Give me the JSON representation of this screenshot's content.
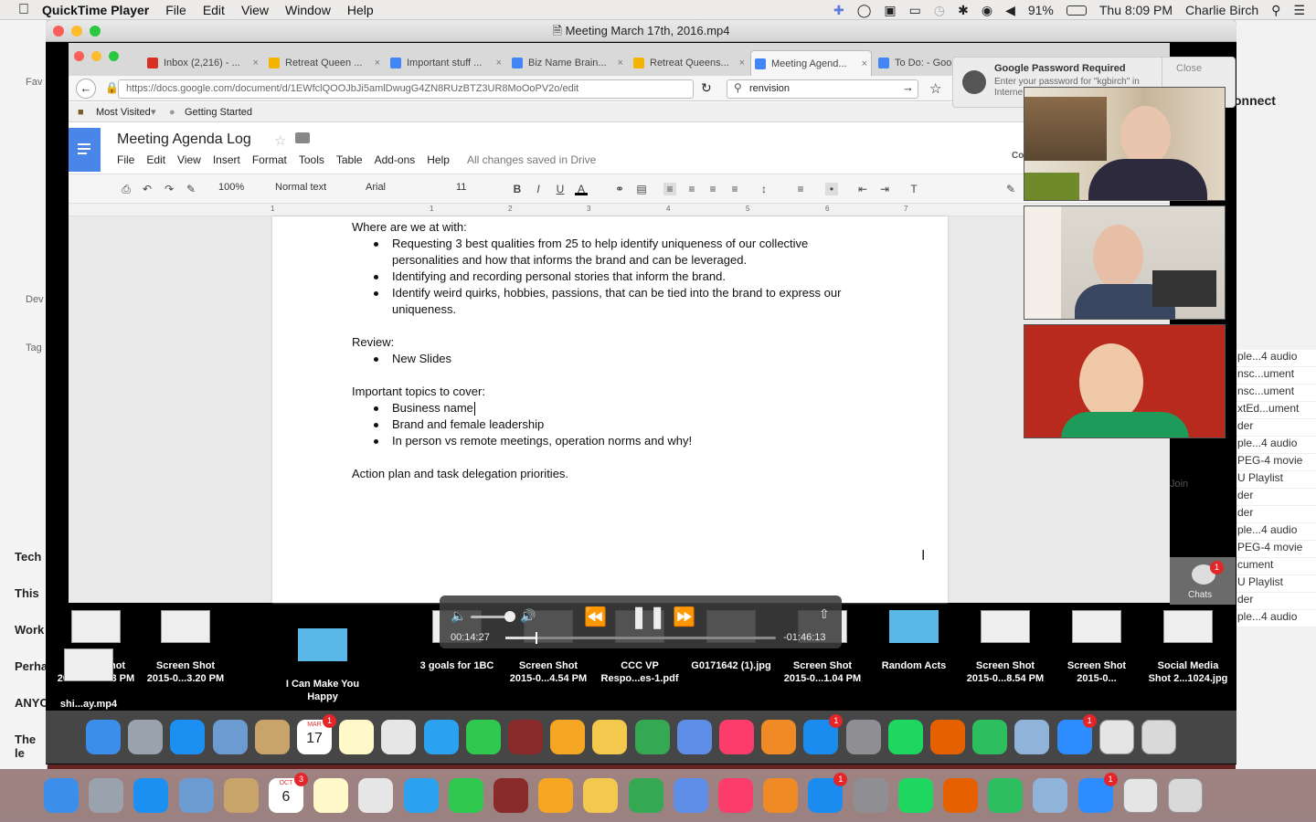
{
  "menubar": {
    "app": "QuickTime Player",
    "items": [
      "File",
      "Edit",
      "View",
      "Window",
      "Help"
    ],
    "battery": "91%",
    "clock": "Thu 8:09 PM",
    "user": "Charlie Birch"
  },
  "qt": {
    "window_title": "Meeting March 17th, 2016.mp4",
    "elapsed": "00:14:27",
    "remaining": "-01:46:13",
    "progress": 0.11
  },
  "browser": {
    "tabs": [
      {
        "label": "Inbox (2,216) - ...",
        "icon_color": "#d93025"
      },
      {
        "label": "Retreat Queen ...",
        "icon_color": "#f4b400"
      },
      {
        "label": "Important stuff ...",
        "icon_color": "#4285f4"
      },
      {
        "label": "Biz Name Brain...",
        "icon_color": "#4285f4"
      },
      {
        "label": "Retreat Queens...",
        "icon_color": "#f4b400"
      },
      {
        "label": "Meeting Agend...",
        "icon_color": "#4285f4"
      },
      {
        "label": "To Do: - Goo",
        "icon_color": "#4285f4"
      }
    ],
    "url": "https://docs.google.com/document/d/1EWfclQOOJbJi5amlDwugG4ZN8RUzBTZ3UR8MoOoPV2o/edit",
    "search": "renvision",
    "bookmarks": [
      "Most Visited",
      "Getting Started"
    ]
  },
  "notification": {
    "title": "Google Password Required",
    "body": "Enter your password for \"kgbirch\" in Interne",
    "close": "Close"
  },
  "docs": {
    "title": "Meeting Agenda Log",
    "menu": [
      "File",
      "Edit",
      "View",
      "Insert",
      "Format",
      "Tools",
      "Table",
      "Add-ons",
      "Help"
    ],
    "saved": "All changes saved in Drive",
    "zoom": "100%",
    "style": "Normal text",
    "font": "Arial",
    "size": "11",
    "ruler": [
      "1",
      "1",
      "2",
      "3",
      "4",
      "5",
      "6",
      "7"
    ],
    "lines": {
      "h1": "Where are we at with:",
      "b1a": "Requesting 3 best qualities from 25 to help identify uniqueness of our collective",
      "b1b": "personalities and how that informs the brand and can be leveraged.",
      "b2": "Identifying and recording personal stories that inform the brand.",
      "b3a": "Identify weird quirks, hobbies, passions, that can be tied into the brand to express our",
      "b3b": "uniqueness.",
      "h2": "Review:",
      "b4": "New Slides",
      "h3": "Important topics to cover:",
      "b5": "Business name",
      "b6": "Brand and female leadership",
      "b7": "In person vs remote meetings, operation norms and why!",
      "h4": "Action plan and task delegation priorities."
    }
  },
  "side_panel": {
    "connect": "onnect",
    "join": "Join",
    "chats": "Chats",
    "chats_badge": "1",
    "partial_c": "Co"
  },
  "right_list": [
    "ple...4 audio",
    "nsc...ument",
    "nsc...ument",
    "xtEd...ument",
    "der",
    "ple...4 audio",
    "PEG-4 movie",
    "U Playlist",
    "der",
    "der",
    "ple...4 audio",
    "PEG-4 movie",
    "cument",
    "U Playlist",
    "der",
    "ple...4 audio"
  ],
  "left_sidebar": [
    "Fav",
    "Dev",
    "Tag",
    "Tech",
    "This",
    "Work",
    "Perha",
    "ANYO",
    "The le"
  ],
  "desktop_files": [
    {
      "name": "Screen Shot\n2015-0...9.03 PM"
    },
    {
      "name": "Screen Shot\n2015-0...3.20 PM"
    },
    {
      "name": "I Can Make You\nHappy"
    },
    {
      "name": "3 goals for 1BC"
    },
    {
      "name": "Screen Shot\n2015-0...4.54 PM"
    },
    {
      "name": "CCC VP\nRespo...es-1.pdf"
    },
    {
      "name": "G0171642 (1).jpg"
    },
    {
      "name": "Screen Shot\n2015-0...1.04 PM"
    },
    {
      "name": "Random Acts"
    },
    {
      "name": "Screen Shot\n2015-0...8.54 PM"
    },
    {
      "name": "Screen Shot\n2015-0..."
    },
    {
      "name": "Social Media\nShot 2...1024.jpg"
    },
    {
      "name": "shi...ay.mp4"
    }
  ],
  "dock_badges": {
    "calendar_month": "MAR",
    "calendar_day": "17",
    "calendar_badge": "1",
    "appstore_badge": "1",
    "zoom_badge": "1",
    "calendar2_month": "OCT",
    "calendar2_day": "6",
    "calendar2_badge": "3",
    "appstore2_badge": "1",
    "zoom2_badge": "1"
  }
}
